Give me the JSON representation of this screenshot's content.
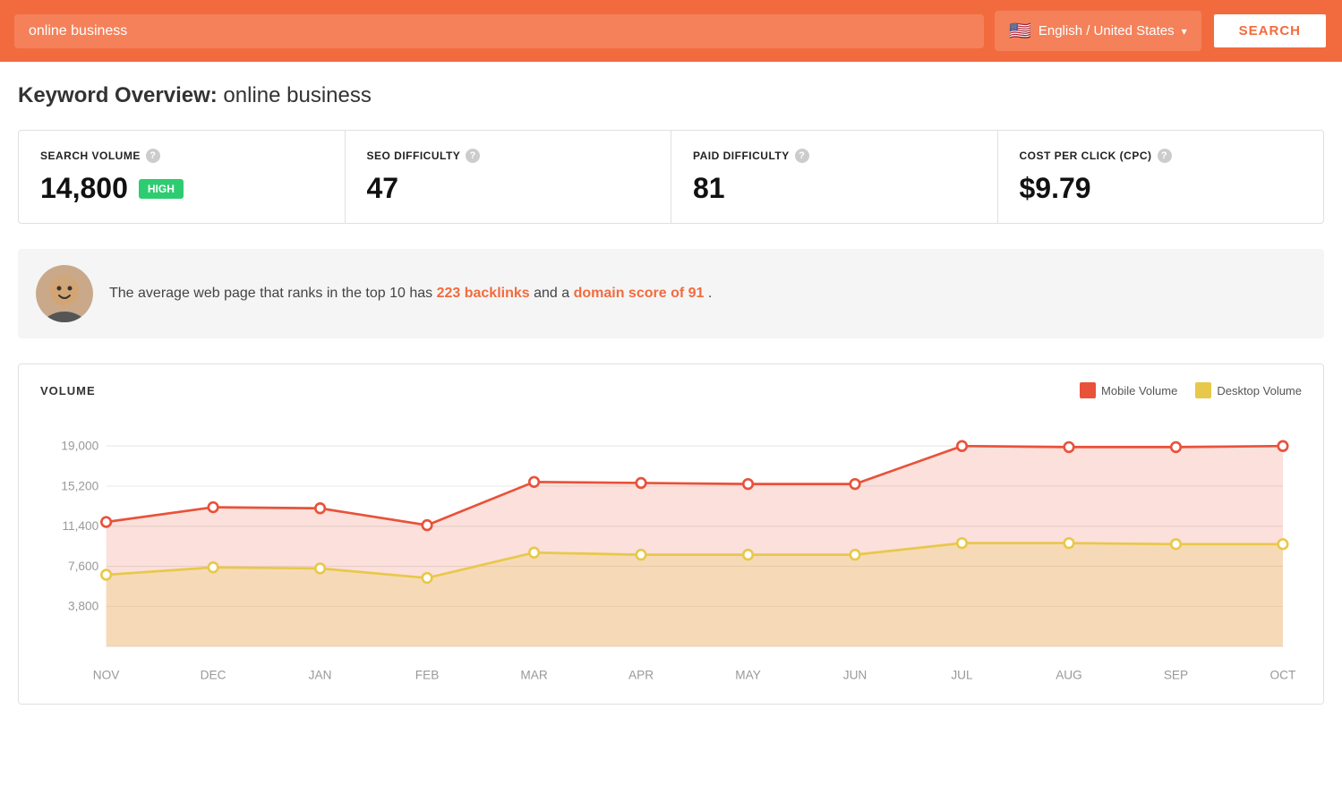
{
  "header": {
    "search_value": "online business",
    "search_placeholder": "online business",
    "language_label": "English / United States",
    "search_button_label": "Search"
  },
  "page": {
    "title_prefix": "Keyword Overview:",
    "title_keyword": "online business",
    "stats": [
      {
        "label": "SEARCH VOLUME",
        "value": "14,800",
        "badge": "HIGH",
        "show_badge": true
      },
      {
        "label": "SEO DIFFICULTY",
        "value": "47",
        "show_badge": false
      },
      {
        "label": "PAID DIFFICULTY",
        "value": "81",
        "show_badge": false
      },
      {
        "label": "COST PER CLICK (CPC)",
        "value": "$9.79",
        "show_badge": false
      }
    ],
    "info_text_before": "The average web page that ranks in the top 10 has ",
    "info_backlinks": "223 backlinks",
    "info_text_middle": " and a ",
    "info_domain": "domain score of 91",
    "info_text_after": ".",
    "chart": {
      "title": "VOLUME",
      "legend": [
        {
          "label": "Mobile Volume",
          "color": "#e8523a"
        },
        {
          "label": "Desktop Volume",
          "color": "#e8c84a"
        }
      ],
      "y_labels": [
        "19,000",
        "15,200",
        "11,400",
        "7,600",
        "3,800"
      ],
      "x_labels": [
        "NOV",
        "DEC",
        "JAN",
        "FEB",
        "MAR",
        "APR",
        "MAY",
        "JUN",
        "JUL",
        "AUG",
        "SEP",
        "OCT"
      ],
      "mobile_data": [
        11800,
        13200,
        13100,
        11500,
        15600,
        15500,
        15400,
        15400,
        19000,
        18900,
        18900,
        19000
      ],
      "desktop_data": [
        6800,
        7500,
        7400,
        6500,
        8900,
        8700,
        8700,
        8700,
        9800,
        9800,
        9700,
        9700
      ]
    }
  }
}
